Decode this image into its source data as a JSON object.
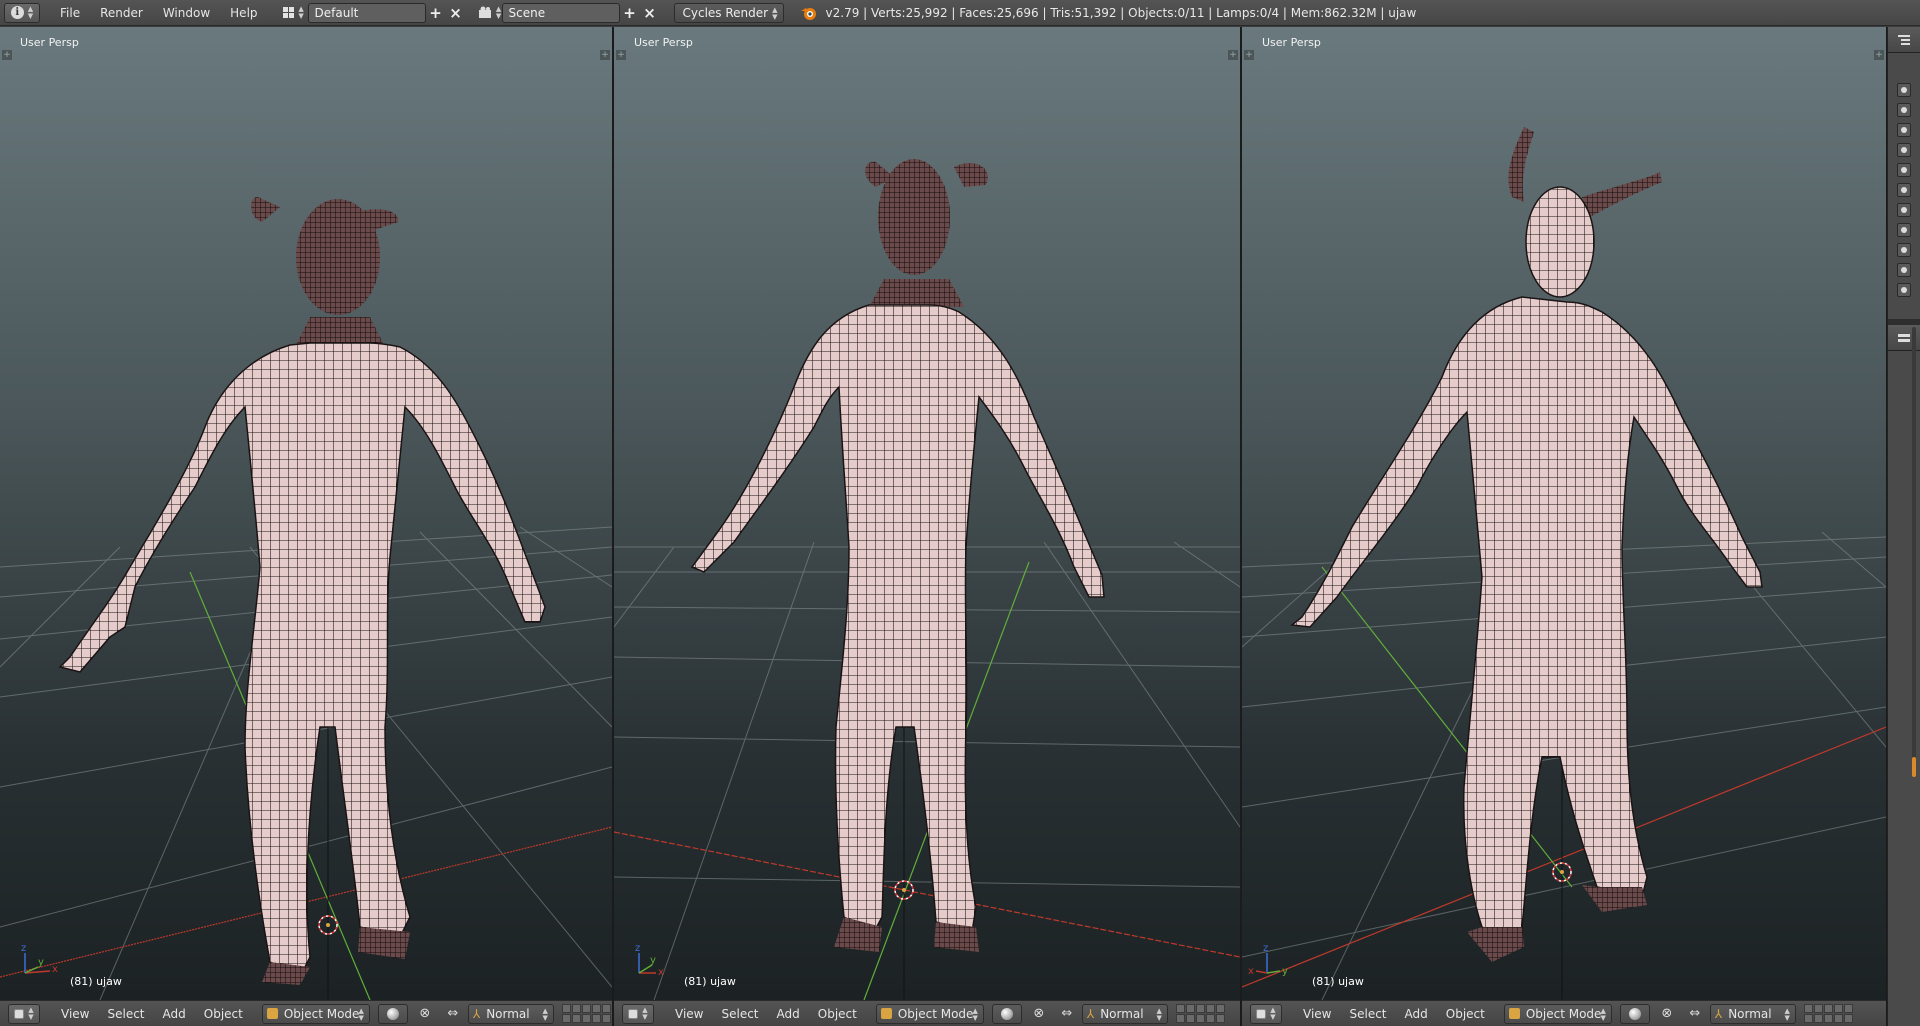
{
  "top_header": {
    "menus": [
      "File",
      "Render",
      "Window",
      "Help"
    ],
    "screen_layout": "Default",
    "scene": "Scene",
    "render_engine": "Cycles Render",
    "stats": "v2.79 | Verts:25,992 | Faces:25,696 | Tris:51,392 | Objects:0/11 | Lamps:0/4 | Mem:862.32M | ujaw"
  },
  "viewports": [
    {
      "label": "User Persp",
      "frame_object": "(81) ujaw"
    },
    {
      "label": "User Persp",
      "frame_object": "(81) ujaw"
    },
    {
      "label": "User Persp",
      "frame_object": "(81) ujaw"
    }
  ],
  "viewport_header": {
    "menus": [
      "View",
      "Select",
      "Add",
      "Object"
    ],
    "mode": "Object Mode",
    "orientation": "Normal"
  },
  "axis_letters": {
    "x": "x",
    "y": "y",
    "z": "z"
  },
  "colors": {
    "x_axis": "#c0392b",
    "y_axis": "#5fae3a",
    "z_axis": "#3b6fd6",
    "mesh_skin": "#e3c7c7",
    "mesh_wire": "#1a1414",
    "accent": "#d9a441"
  },
  "icons": {
    "info": "info-icon",
    "layout": "grid-layout-icon",
    "scene": "scene-icon",
    "blender": "blender-logo-icon",
    "cube": "cube-icon",
    "shading": "solid-sphere-icon",
    "pivot": "pivot-icon",
    "manipulator": "manipulator-icon"
  }
}
